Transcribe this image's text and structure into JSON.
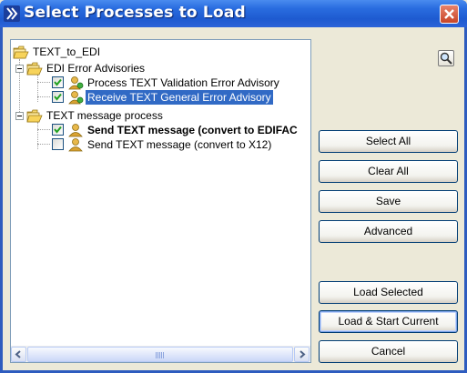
{
  "window": {
    "title": "Select Processes to Load",
    "title_icon": "double-chevron-icon",
    "close_icon": "close-icon"
  },
  "tree": {
    "root": {
      "label": "TEXT_to_EDI",
      "icon": "folder-open-icon"
    },
    "groups": [
      {
        "label": "EDI Error Advisories",
        "expanded": true,
        "items": [
          {
            "label": "Process TEXT Validation Error Advisory",
            "checked": true,
            "bold": false,
            "selected": false
          },
          {
            "label": "Receive TEXT General Error Advisory",
            "checked": true,
            "bold": false,
            "selected": true
          }
        ]
      },
      {
        "label": "TEXT message process",
        "expanded": true,
        "items": [
          {
            "label": "Send TEXT message (convert to EDIFAC",
            "checked": true,
            "bold": true,
            "selected": false
          },
          {
            "label": "Send TEXT message (convert to X12)",
            "checked": false,
            "bold": false,
            "selected": false
          }
        ]
      }
    ]
  },
  "buttons": {
    "zoom_icon": "magnifier-icon",
    "select_all": "Select All",
    "clear_all": "Clear All",
    "save": "Save",
    "advanced": "Advanced",
    "load_selected": "Load Selected",
    "load_start_current": "Load & Start Current",
    "cancel": "Cancel"
  }
}
